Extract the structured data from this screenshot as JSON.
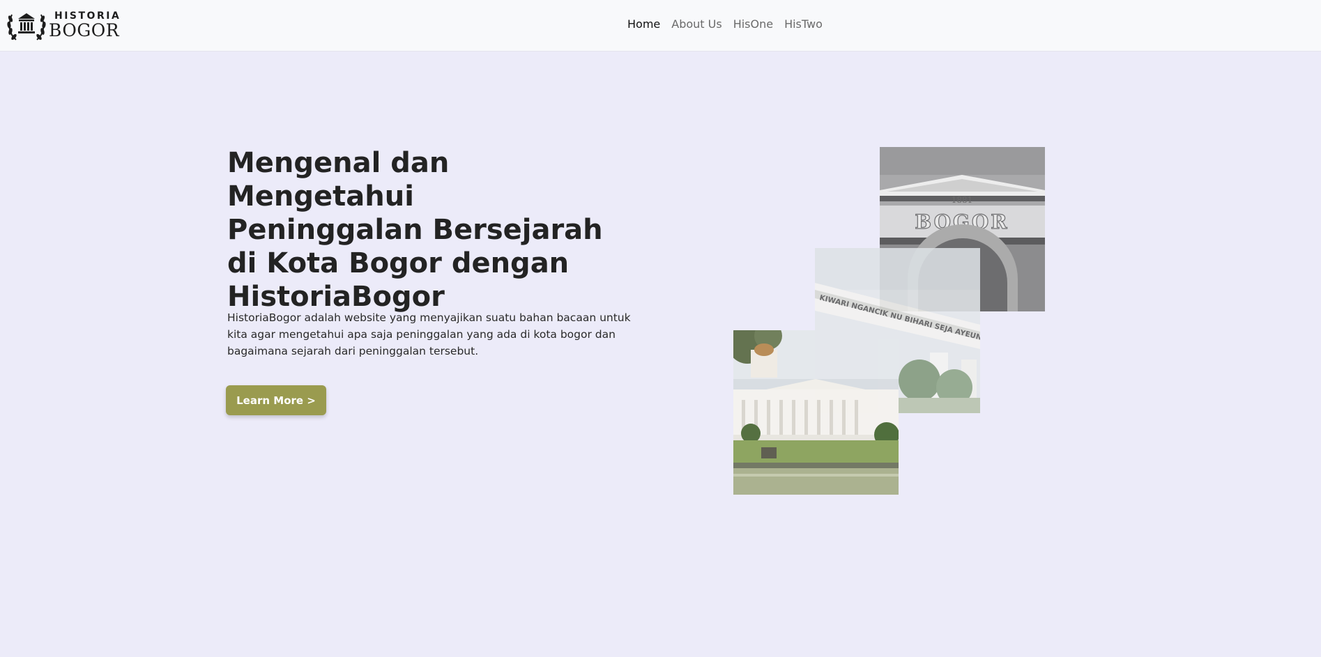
{
  "nav": {
    "brand_top": "HISTORIA",
    "brand_bottom": "BOGOR",
    "links": [
      {
        "label": "Home",
        "active": true
      },
      {
        "label": "About Us",
        "active": false
      },
      {
        "label": "HisOne",
        "active": false
      },
      {
        "label": "HisTwo",
        "active": false
      }
    ]
  },
  "hero": {
    "title": "Mengenal dan Mengetahui Peninggalan Bersejarah di Kota Bogor dengan HistoriaBogor",
    "description": "HistoriaBogor adalah website yang menyajikan suatu bahan bacaan untuk kita agar mengetahui apa saja peninggalan yang ada di kota bogor dan bagaimana sejarah dari peninggalan tersebut.",
    "button_label": "Learn More >"
  },
  "photos": {
    "arch_year": "1881",
    "arch_name": "BOGOR",
    "gate_inscription": "KIWARI NGANCIK NU BIHARI SEJA AYEUNA SAMPEUREUN"
  },
  "colors": {
    "background": "#ecebf9",
    "navbar": "#f8f9fb",
    "button": "#9a9b4f"
  }
}
